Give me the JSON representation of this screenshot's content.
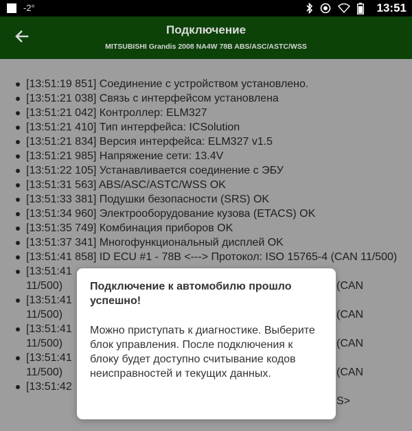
{
  "status_bar": {
    "temperature": "-2°",
    "time": "13:51",
    "icons": [
      "bluetooth-icon",
      "sync-icon",
      "wifi-icon",
      "battery-icon"
    ]
  },
  "app_bar": {
    "back_icon": "back-arrow-icon",
    "title": "Подключение",
    "subtitle": "MITSUBISHI Grandis 2008 NA4W 78B ABS/ASC/ASTC/WSS"
  },
  "log": {
    "entries": [
      "[13:51:19 851] Соединение с устройством установлено.",
      "[13:51:21 038] Связь с интерфейсом установлена",
      "[13:51:21 042] Контроллер: ELM327",
      "[13:51:21 410] Тип интерфейса: ICSolution",
      "[13:51:21 834] Версия интерфейса: ELM327 v1.5",
      "[13:51:21 985] Напряжение сети: 13.4V",
      "[13:51:22 105] Устанавливается соединение с ЭБУ",
      "[13:51:31 563] ABS/ASC/ASTC/WSS OK",
      "[13:51:33 381] Подушки безопасности (SRS) OK",
      "[13:51:34 960] Электрооборудование кузова (ETACS) OK",
      "[13:51:35 749] Комбинация приборов OK",
      "[13:51:37 341] Многофункциональный дисплей OK",
      "[13:51:41 858] ID ECU #1 - 78B <---> Протокол: ISO 15765-4 (CAN 11/500)",
      "[13:51:41 ",
      "11/500)",
      "[13:51:41 ",
      "11/500)",
      "[13:51:41 ",
      "11/500)",
      "[13:51:41 ",
      "11/500)",
      "[13:51:42 "
    ],
    "peek_right": [
      "(CAN",
      "(CAN",
      "(CAN",
      "(CAN",
      "S>"
    ]
  },
  "dialog": {
    "title": "Подключение к автомобилю прошло успешно!",
    "message": "Можно приступать к диагностике. Выберите блок управления. После подключения к блоку будет доступно считывание кодов неисправностей и текущих данных."
  },
  "colors": {
    "app_bar": "#0c4208",
    "overlay_bg": "#9d9d9d",
    "status_bar": "#000000"
  }
}
